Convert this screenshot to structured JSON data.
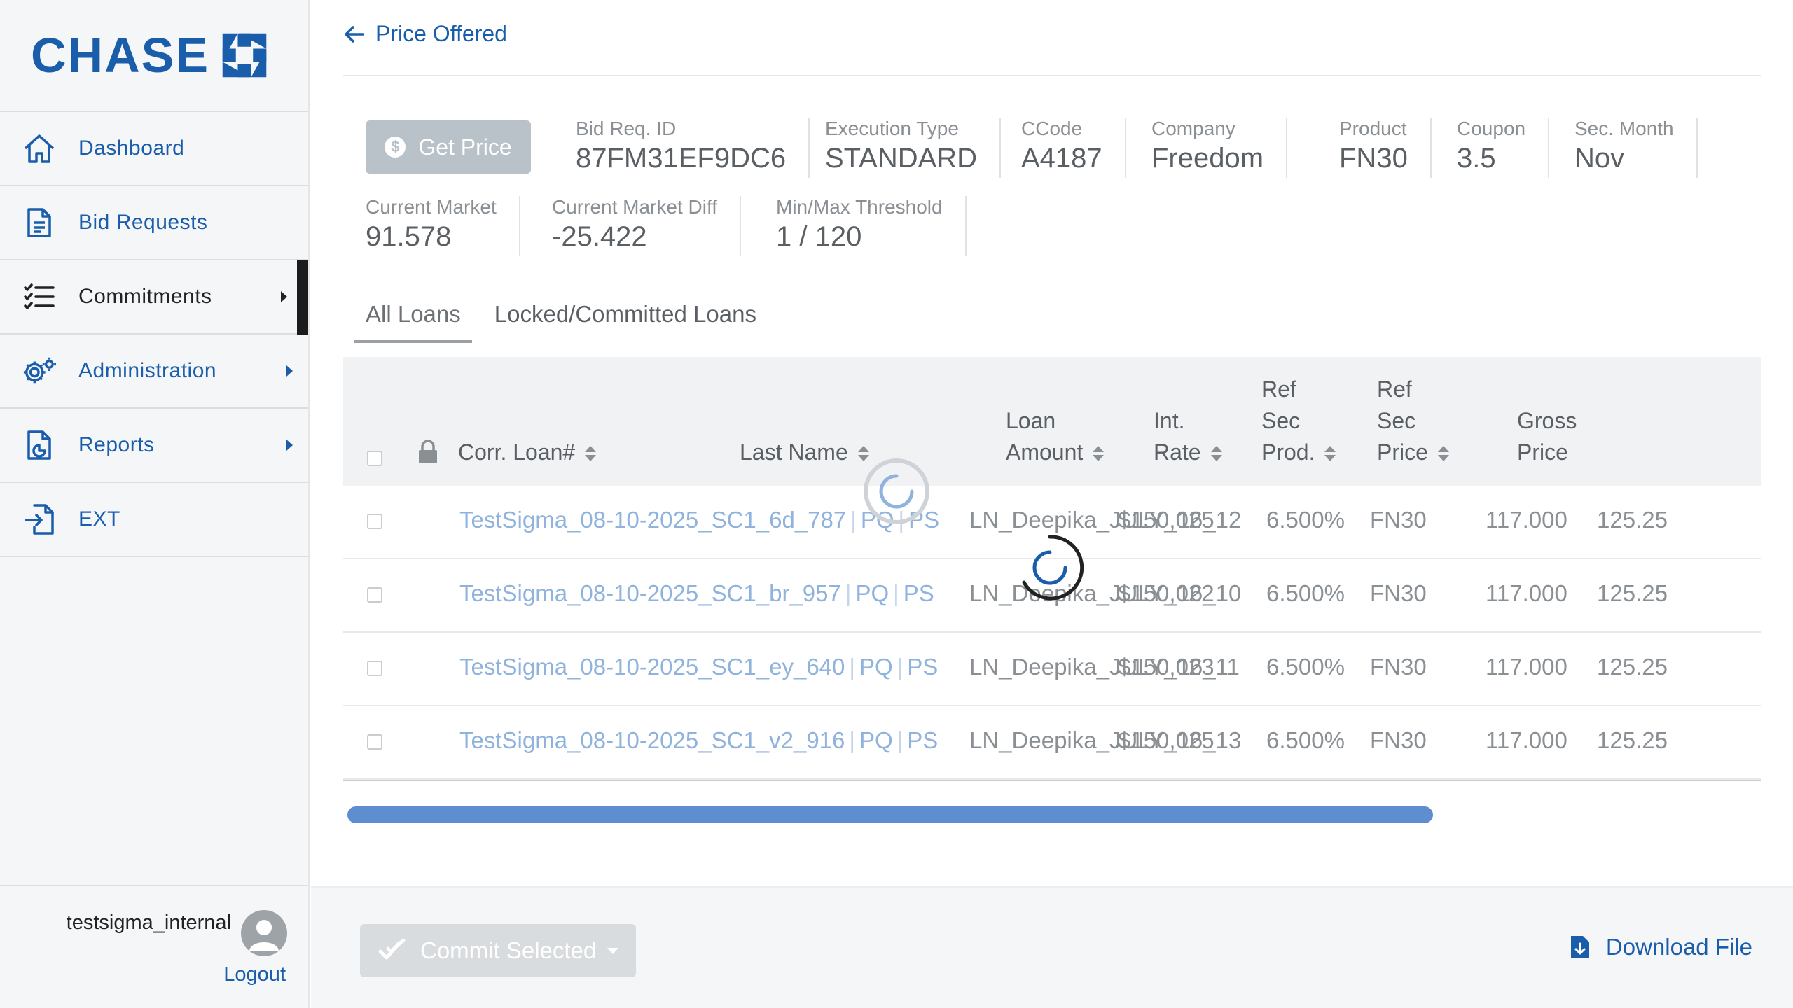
{
  "brand": {
    "name": "CHASE",
    "color": "#1a5dab"
  },
  "sidebar": {
    "items": [
      {
        "label": "Dashboard",
        "icon": "home-icon"
      },
      {
        "label": "Bid Requests",
        "icon": "document-icon"
      },
      {
        "label": "Commitments",
        "icon": "checklist-icon",
        "active": true
      },
      {
        "label": "Administration",
        "icon": "gears-icon"
      },
      {
        "label": "Reports",
        "icon": "report-icon"
      },
      {
        "label": "EXT",
        "icon": "export-icon"
      }
    ],
    "user": {
      "name": "testsigma_internal",
      "logout": "Logout"
    }
  },
  "header": {
    "back_title": "Price Offered"
  },
  "actions": {
    "get_price": "Get Price",
    "commit_selected": "Commit Selected",
    "download_file": "Download File"
  },
  "bid_info": {
    "bid_req_id": {
      "label": "Bid Req. ID",
      "value": "87FM31EF9DC6"
    },
    "execution_type": {
      "label": "Execution Type",
      "value": "STANDARD"
    },
    "ccode": {
      "label": "CCode",
      "value": "A4187"
    },
    "company": {
      "label": "Company",
      "value": "Freedom"
    },
    "product": {
      "label": "Product",
      "value": "FN30"
    },
    "coupon": {
      "label": "Coupon",
      "value": "3.5"
    },
    "sec_month": {
      "label": "Sec. Month",
      "value": "Nov"
    },
    "current_market": {
      "label": "Current Market",
      "value": "91.578"
    },
    "current_market_diff": {
      "label": "Current Market Diff",
      "value": "-25.422"
    },
    "min_max_threshold": {
      "label": "Min/Max Threshold",
      "value": "1 / 120"
    }
  },
  "tabs": [
    {
      "label": "All Loans",
      "active": true
    },
    {
      "label": "Locked/Committed Loans"
    }
  ],
  "table": {
    "columns": {
      "corr_loan": "Corr. Loan#",
      "last_name": "Last Name",
      "loan_amount_1": "Loan",
      "loan_amount_2": "Amount",
      "int_rate_1": "Int.",
      "int_rate_2": "Rate",
      "ref_sec_prod_1": "Ref",
      "ref_sec_prod_2": "Sec",
      "ref_sec_prod_3": "Prod.",
      "ref_sec_price_1": "Ref",
      "ref_sec_price_2": "Sec",
      "ref_sec_price_3": "Price",
      "gross_price_1": "Gross",
      "gross_price_2": "Price"
    },
    "rows": [
      {
        "loan": "TestSigma_08-10-2025_SC1_6d_787",
        "pq": "PQ",
        "ps": "PS",
        "last_name": "LN_Deepika_JULY_16_12",
        "amount": "$150,025",
        "rate": "6.500%",
        "prod": "FN30",
        "price": "117.000",
        "gross": "125.25"
      },
      {
        "loan": "TestSigma_08-10-2025_SC1_br_957",
        "pq": "PQ",
        "ps": "PS",
        "last_name": "LN_Deepika_JULY_16_10",
        "amount": "$150,022",
        "rate": "6.500%",
        "prod": "FN30",
        "price": "117.000",
        "gross": "125.25"
      },
      {
        "loan": "TestSigma_08-10-2025_SC1_ey_640",
        "pq": "PQ",
        "ps": "PS",
        "last_name": "LN_Deepika_JULY_16_11",
        "amount": "$150,023",
        "rate": "6.500%",
        "prod": "FN30",
        "price": "117.000",
        "gross": "125.25"
      },
      {
        "loan": "TestSigma_08-10-2025_SC1_v2_916",
        "pq": "PQ",
        "ps": "PS",
        "last_name": "LN_Deepika_JULY_16_13",
        "amount": "$150,025",
        "rate": "6.500%",
        "prod": "FN30",
        "price": "117.000",
        "gross": "125.25"
      }
    ]
  }
}
